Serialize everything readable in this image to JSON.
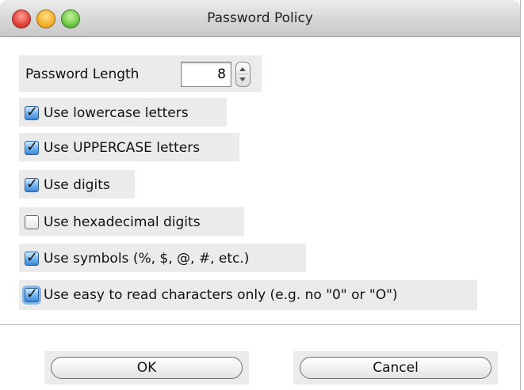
{
  "window": {
    "title": "Password Policy"
  },
  "length": {
    "label": "Password Length",
    "value": "8"
  },
  "options": [
    {
      "label": "Use lowercase letters",
      "checked": true
    },
    {
      "label": "Use UPPERCASE letters",
      "checked": true
    },
    {
      "label": "Use digits",
      "checked": true
    },
    {
      "label": "Use hexadecimal digits",
      "checked": false
    },
    {
      "label": "Use symbols (%, $, @, #, etc.)",
      "checked": true
    },
    {
      "label": "Use easy to read characters only (e.g. no \"0\" or \"O\")",
      "checked": true,
      "focused": true
    }
  ],
  "buttons": {
    "ok": "OK",
    "cancel": "Cancel"
  }
}
